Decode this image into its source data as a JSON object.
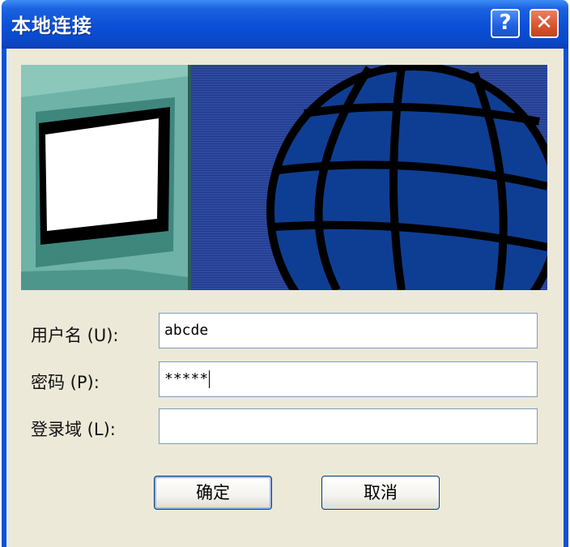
{
  "window": {
    "title": "本地连接",
    "help_label": "?",
    "close_label": "✕"
  },
  "banner": {
    "icons": [
      "computer-monitor",
      "globe"
    ]
  },
  "form": {
    "username": {
      "label": "用户名 (U):",
      "value": "abcde"
    },
    "password": {
      "label": "密码 (P):",
      "value": "*****"
    },
    "domain": {
      "label": "登录域 (L):",
      "value": ""
    }
  },
  "buttons": {
    "ok_label": "确定",
    "cancel_label": "取消"
  },
  "colors": {
    "titlebar": "#0a4fd6",
    "client_bg": "#ece9d8",
    "banner_bg": "#2d4aa0",
    "globe": "#0e3e93",
    "monitor": "#5aa49a"
  }
}
